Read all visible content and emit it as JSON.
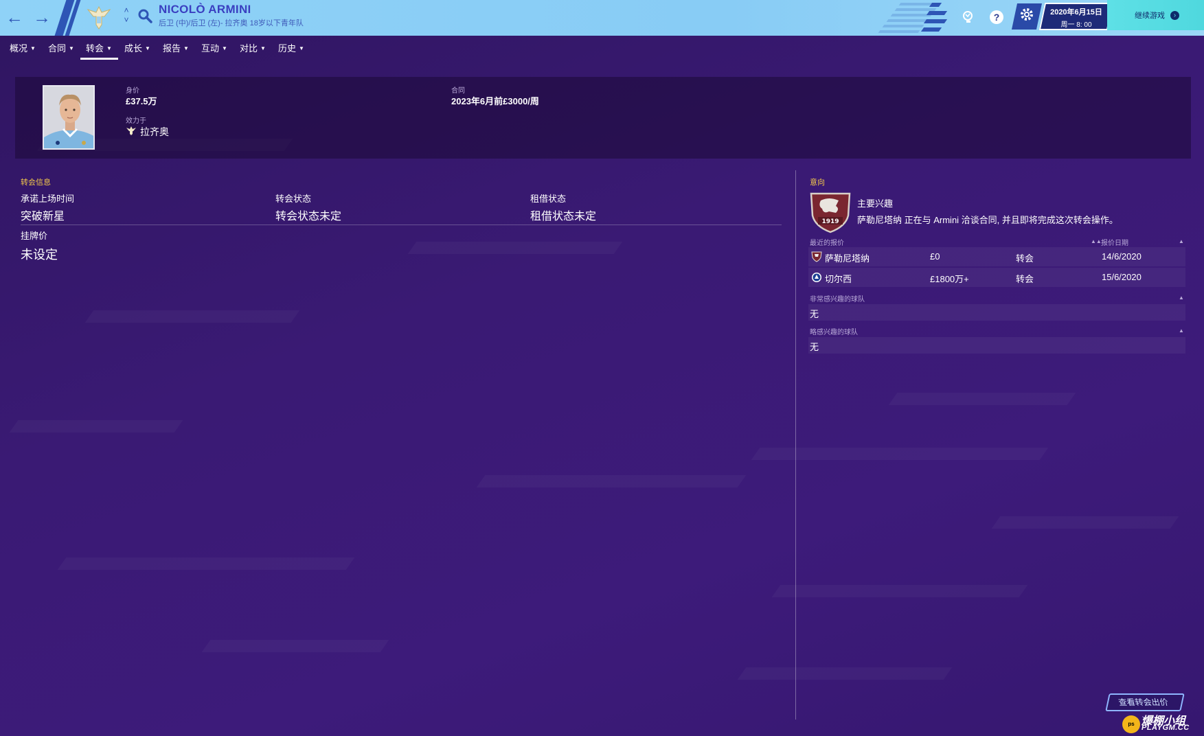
{
  "header": {
    "player_name": "NICOLÒ ARMINI",
    "player_subtitle": "后卫 (中)/后卫 (左)- 拉齐奥 18岁以下青年队",
    "date": "2020年6月15日",
    "weekday_time": "周一 8: 00",
    "continue_label": "继续游戏"
  },
  "menu": {
    "items": [
      "概况",
      "合同",
      "转会",
      "成长",
      "报告",
      "互动",
      "对比",
      "历史"
    ],
    "active_index": 2
  },
  "card": {
    "value_label": "身价",
    "value": "£37.5万",
    "club_label": "效力于",
    "club": "拉齐奥",
    "contract_label": "合同",
    "contract": "2023年6月前£3000/周"
  },
  "transfer_info": {
    "title": "转会信息",
    "promise_label": "承诺上场时间",
    "promise_value": "突破新星",
    "status_label": "转会状态",
    "status_value": "转会状态未定",
    "loan_label": "租借状态",
    "loan_value": "租借状态未定",
    "asking_label": "挂牌价",
    "asking_value": "未设定"
  },
  "intent": {
    "title": "意向",
    "shield_year": "1919",
    "main_interest_title": "主要兴趣",
    "main_interest_text": "萨勒尼塔纳 正在与 Armini 洽谈合同, 并且即将完成这次转会操作。",
    "recent_offers_label": "最近的报价",
    "offer_date_label": "报价日期",
    "offers": [
      {
        "club": "萨勒尼塔纳",
        "fee": "£0",
        "type": "转会",
        "date": "14/6/2020",
        "icon": "salernitana-crest-icon"
      },
      {
        "club": "切尔西",
        "fee": "£1800万+",
        "type": "转会",
        "date": "15/6/2020",
        "icon": "chelsea-crest-icon"
      }
    ],
    "very_interested_label": "非常感兴趣的球队",
    "very_interested_value": "无",
    "slightly_interested_label": "略感兴趣的球队",
    "slightly_interested_value": "无"
  },
  "footer": {
    "view_offers_label": "查看转会出价",
    "watermark_main": "爆棚小组",
    "watermark_sub": "PLAYGM.CC",
    "watermark_badge": "ps"
  },
  "colors": {
    "topbar": "#8fd2f7",
    "background": "#3a1a74",
    "accent_yellow": "#f4c94a",
    "continue_button": "#5ee0e6",
    "accent_blue": "#2e55b5"
  }
}
